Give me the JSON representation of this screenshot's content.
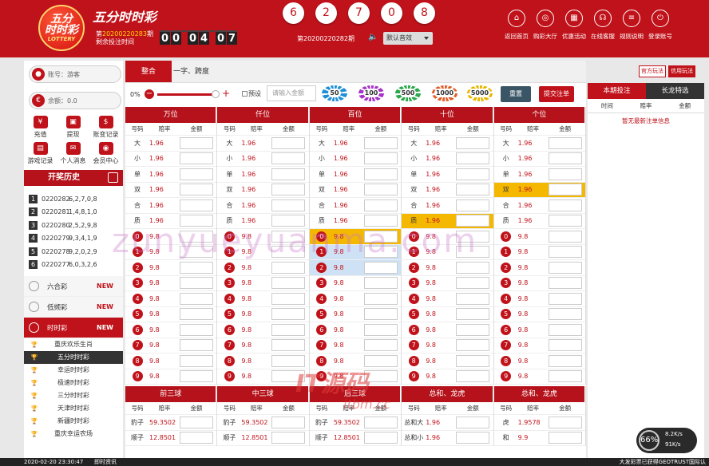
{
  "header": {
    "logo_line1": "五分",
    "logo_line2": "时时彩",
    "logo_line3": "LOTTERY",
    "title": "五分时时彩",
    "current_issue_prefix": "第",
    "current_issue": "20200220283",
    "current_issue_suffix": "期",
    "deadline_label": "剩余投注时间",
    "timer": [
      "0",
      "0",
      "0",
      "4",
      "0",
      "7"
    ],
    "result_balls": [
      "6",
      "2",
      "7",
      "0",
      "8"
    ],
    "last_issue": "第20200220282期",
    "sound_select": "默认音效",
    "nav": [
      {
        "label": "返回首页",
        "icon": "home-icon",
        "glyph": "⌂"
      },
      {
        "label": "购彩大厅",
        "icon": "lottery-hall-icon",
        "glyph": "◎"
      },
      {
        "label": "优惠活动",
        "icon": "gift-icon",
        "glyph": "▦"
      },
      {
        "label": "在线客服",
        "icon": "headset-icon",
        "glyph": "☊"
      },
      {
        "label": "规则说明",
        "icon": "rules-icon",
        "glyph": "≡"
      },
      {
        "label": "登录账号",
        "icon": "power-icon",
        "glyph": "⏻"
      }
    ]
  },
  "sidebar": {
    "account": "账号：游客",
    "balance": "余额：0.0",
    "grid": [
      {
        "label": "充值",
        "icon": "yen-icon",
        "glyph": "¥"
      },
      {
        "label": "提现",
        "icon": "withdraw-icon",
        "glyph": "▣"
      },
      {
        "label": "账变记录",
        "icon": "ledger-icon",
        "glyph": "$"
      },
      {
        "label": "游戏记录",
        "icon": "record-icon",
        "glyph": "▤"
      },
      {
        "label": "个人消息",
        "icon": "message-icon",
        "glyph": "✉"
      },
      {
        "label": "会员中心",
        "icon": "user-icon",
        "glyph": "◉"
      }
    ],
    "history_title": "开奖历史",
    "history": [
      {
        "n": "1",
        "issue": "0220282",
        "result": "6,2,7,0,8"
      },
      {
        "n": "2",
        "issue": "0220281",
        "result": "1,4,8,1,0"
      },
      {
        "n": "3",
        "issue": "0220280",
        "result": "2,5,2,9,8"
      },
      {
        "n": "4",
        "issue": "0220279",
        "result": "9,3,4,1,9"
      },
      {
        "n": "5",
        "issue": "0220278",
        "result": "9,2,0,2,9"
      },
      {
        "n": "6",
        "issue": "0220277",
        "result": "6,0,3,2,6"
      }
    ],
    "categories": [
      {
        "label": "六合彩",
        "badge": "NEW"
      },
      {
        "label": "低频彩",
        "badge": "NEW"
      },
      {
        "label": "时时彩",
        "badge": "NEW"
      }
    ],
    "sub_items": [
      "重庆欢乐生肖",
      "五分时时彩",
      "幸运时时彩",
      "极速时时彩",
      "三分时时彩",
      "天津时时彩",
      "新疆时时彩",
      "重庆幸运农场"
    ]
  },
  "main": {
    "tabs": [
      "整合",
      "一字、跨度"
    ],
    "ctrl": {
      "pct": "0%",
      "preset": "预设",
      "amount_placeholder": "请输入金额",
      "chips": [
        "50",
        "100",
        "500",
        "1000",
        "5000"
      ],
      "reset": "重置",
      "submit": "提交注单"
    },
    "columns": [
      "万位",
      "仟位",
      "百位",
      "十位",
      "个位"
    ],
    "sub_header": [
      "号码",
      "赔率",
      "金额"
    ],
    "attr_rows": [
      {
        "label": "大",
        "odds": "1.96"
      },
      {
        "label": "小",
        "odds": "1.96"
      },
      {
        "label": "单",
        "odds": "1.96"
      },
      {
        "label": "双",
        "odds": "1.96"
      },
      {
        "label": "合",
        "odds": "1.96"
      },
      {
        "label": "质",
        "odds": "1.96"
      }
    ],
    "num_odds": "9.8",
    "numbers": [
      "0",
      "1",
      "2",
      "3",
      "4",
      "5",
      "6",
      "7",
      "8",
      "9"
    ],
    "bottom_columns": [
      "前三球",
      "中三球",
      "后三球",
      "总和、龙虎",
      "总和、龙虎"
    ],
    "bottom_rows": [
      [
        {
          "label": "豹子",
          "odds": "59.3502"
        },
        {
          "label": "顺子",
          "odds": "12.8501"
        }
      ],
      [
        {
          "label": "豹子",
          "odds": "59.3502"
        },
        {
          "label": "顺子",
          "odds": "12.8501"
        }
      ],
      [
        {
          "label": "豹子",
          "odds": "59.3502"
        },
        {
          "label": "顺子",
          "odds": "12.8501"
        }
      ],
      [
        {
          "label": "总和大",
          "odds": "1.96"
        },
        {
          "label": "总和小",
          "odds": "1.96"
        }
      ],
      [
        {
          "label": "虎",
          "odds": "1.9578"
        },
        {
          "label": "和",
          "odds": "9.9"
        }
      ]
    ]
  },
  "right": {
    "btn_official": "官方玩法",
    "btn_credit": "信用玩法",
    "tabs": [
      "本期投注",
      "长龙特选"
    ],
    "headers": [
      "时间",
      "赔率",
      "金额"
    ],
    "empty": "暂无最新注单信息"
  },
  "footer": {
    "left": "2020-02-20 23:30:47",
    "news": "即时资讯",
    "right": "大发彩票已获得GEOTRUST国际认"
  },
  "speed": {
    "pct": "66%",
    "up": "8.2K/s",
    "down": "91K/s"
  },
  "watermark": {
    "w1": "zunyueyuanma.com",
    "w2": "IT源码",
    "w3": "itbm.cc"
  },
  "colors": {
    "brand_red": "#c0121a",
    "highlight": "#f5b800"
  }
}
